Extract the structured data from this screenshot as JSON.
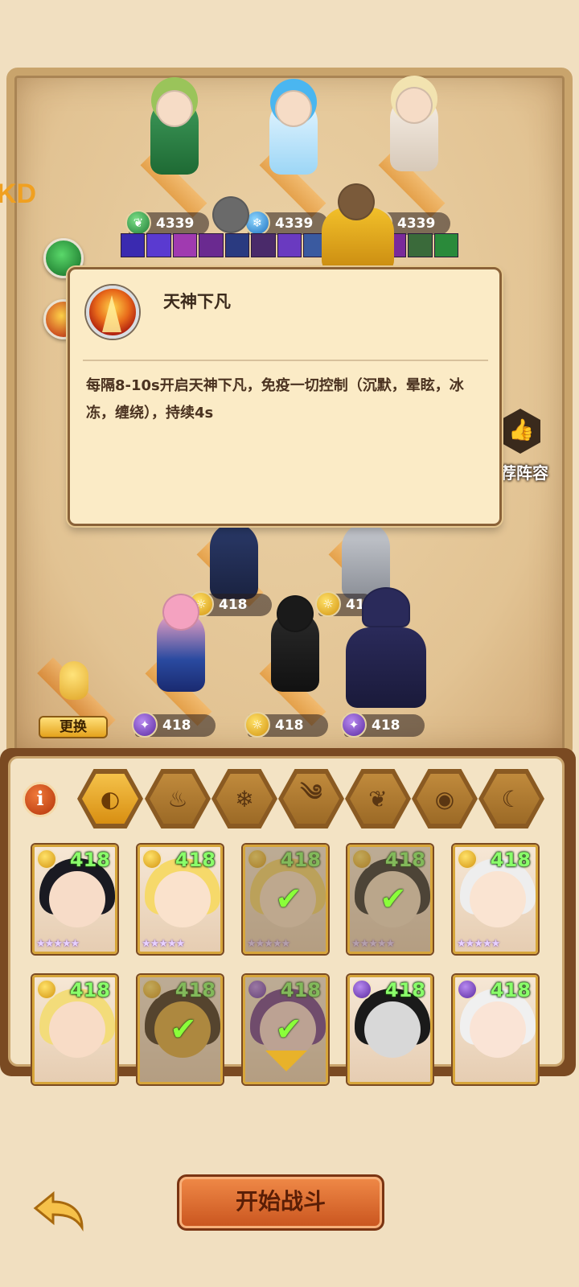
{
  "board": {
    "edge_tag": "KD",
    "top_row_powers": [
      "4339",
      "4339",
      "4339"
    ],
    "team_powers": [
      "418",
      "418",
      "418",
      "418",
      "418"
    ],
    "recommend_label": "荐阵容",
    "change_button": "更换"
  },
  "skill_popup": {
    "title": "天神下凡",
    "description": "每隔8-10s开启天神下凡，免疫一切控制（沉默，晕眩，冰冻，缠绕），持续4s"
  },
  "roster": {
    "info_button": "i",
    "element_tabs": [
      {
        "name": "all",
        "active": true
      },
      {
        "name": "fire",
        "active": false
      },
      {
        "name": "ice",
        "active": false
      },
      {
        "name": "wind",
        "active": false
      },
      {
        "name": "nature",
        "active": false
      },
      {
        "name": "dark",
        "active": false
      },
      {
        "name": "light",
        "active": false
      }
    ],
    "cards": [
      {
        "power": "418",
        "element": "gold",
        "stars": "★★★★★",
        "selected": false
      },
      {
        "power": "418",
        "element": "gold",
        "stars": "★★★★★",
        "selected": false
      },
      {
        "power": "418",
        "element": "gold",
        "stars": "★★★★★",
        "selected": true
      },
      {
        "power": "418",
        "element": "gold",
        "stars": "★★★★★",
        "selected": true
      },
      {
        "power": "418",
        "element": "gold",
        "stars": "★★★★★",
        "selected": false
      },
      {
        "power": "418",
        "element": "gold",
        "stars": "",
        "selected": false
      },
      {
        "power": "418",
        "element": "gold",
        "stars": "",
        "selected": true
      },
      {
        "power": "418",
        "element": "purple",
        "stars": "",
        "selected": true
      },
      {
        "power": "418",
        "element": "purple",
        "stars": "",
        "selected": false
      },
      {
        "power": "418",
        "element": "purple",
        "stars": "",
        "selected": false
      }
    ]
  },
  "footer": {
    "start_button": "开始战斗"
  },
  "colors": {
    "accent_orange": "#c9541e",
    "power_green": "#8aff6a",
    "gold": "#e4a21c"
  }
}
